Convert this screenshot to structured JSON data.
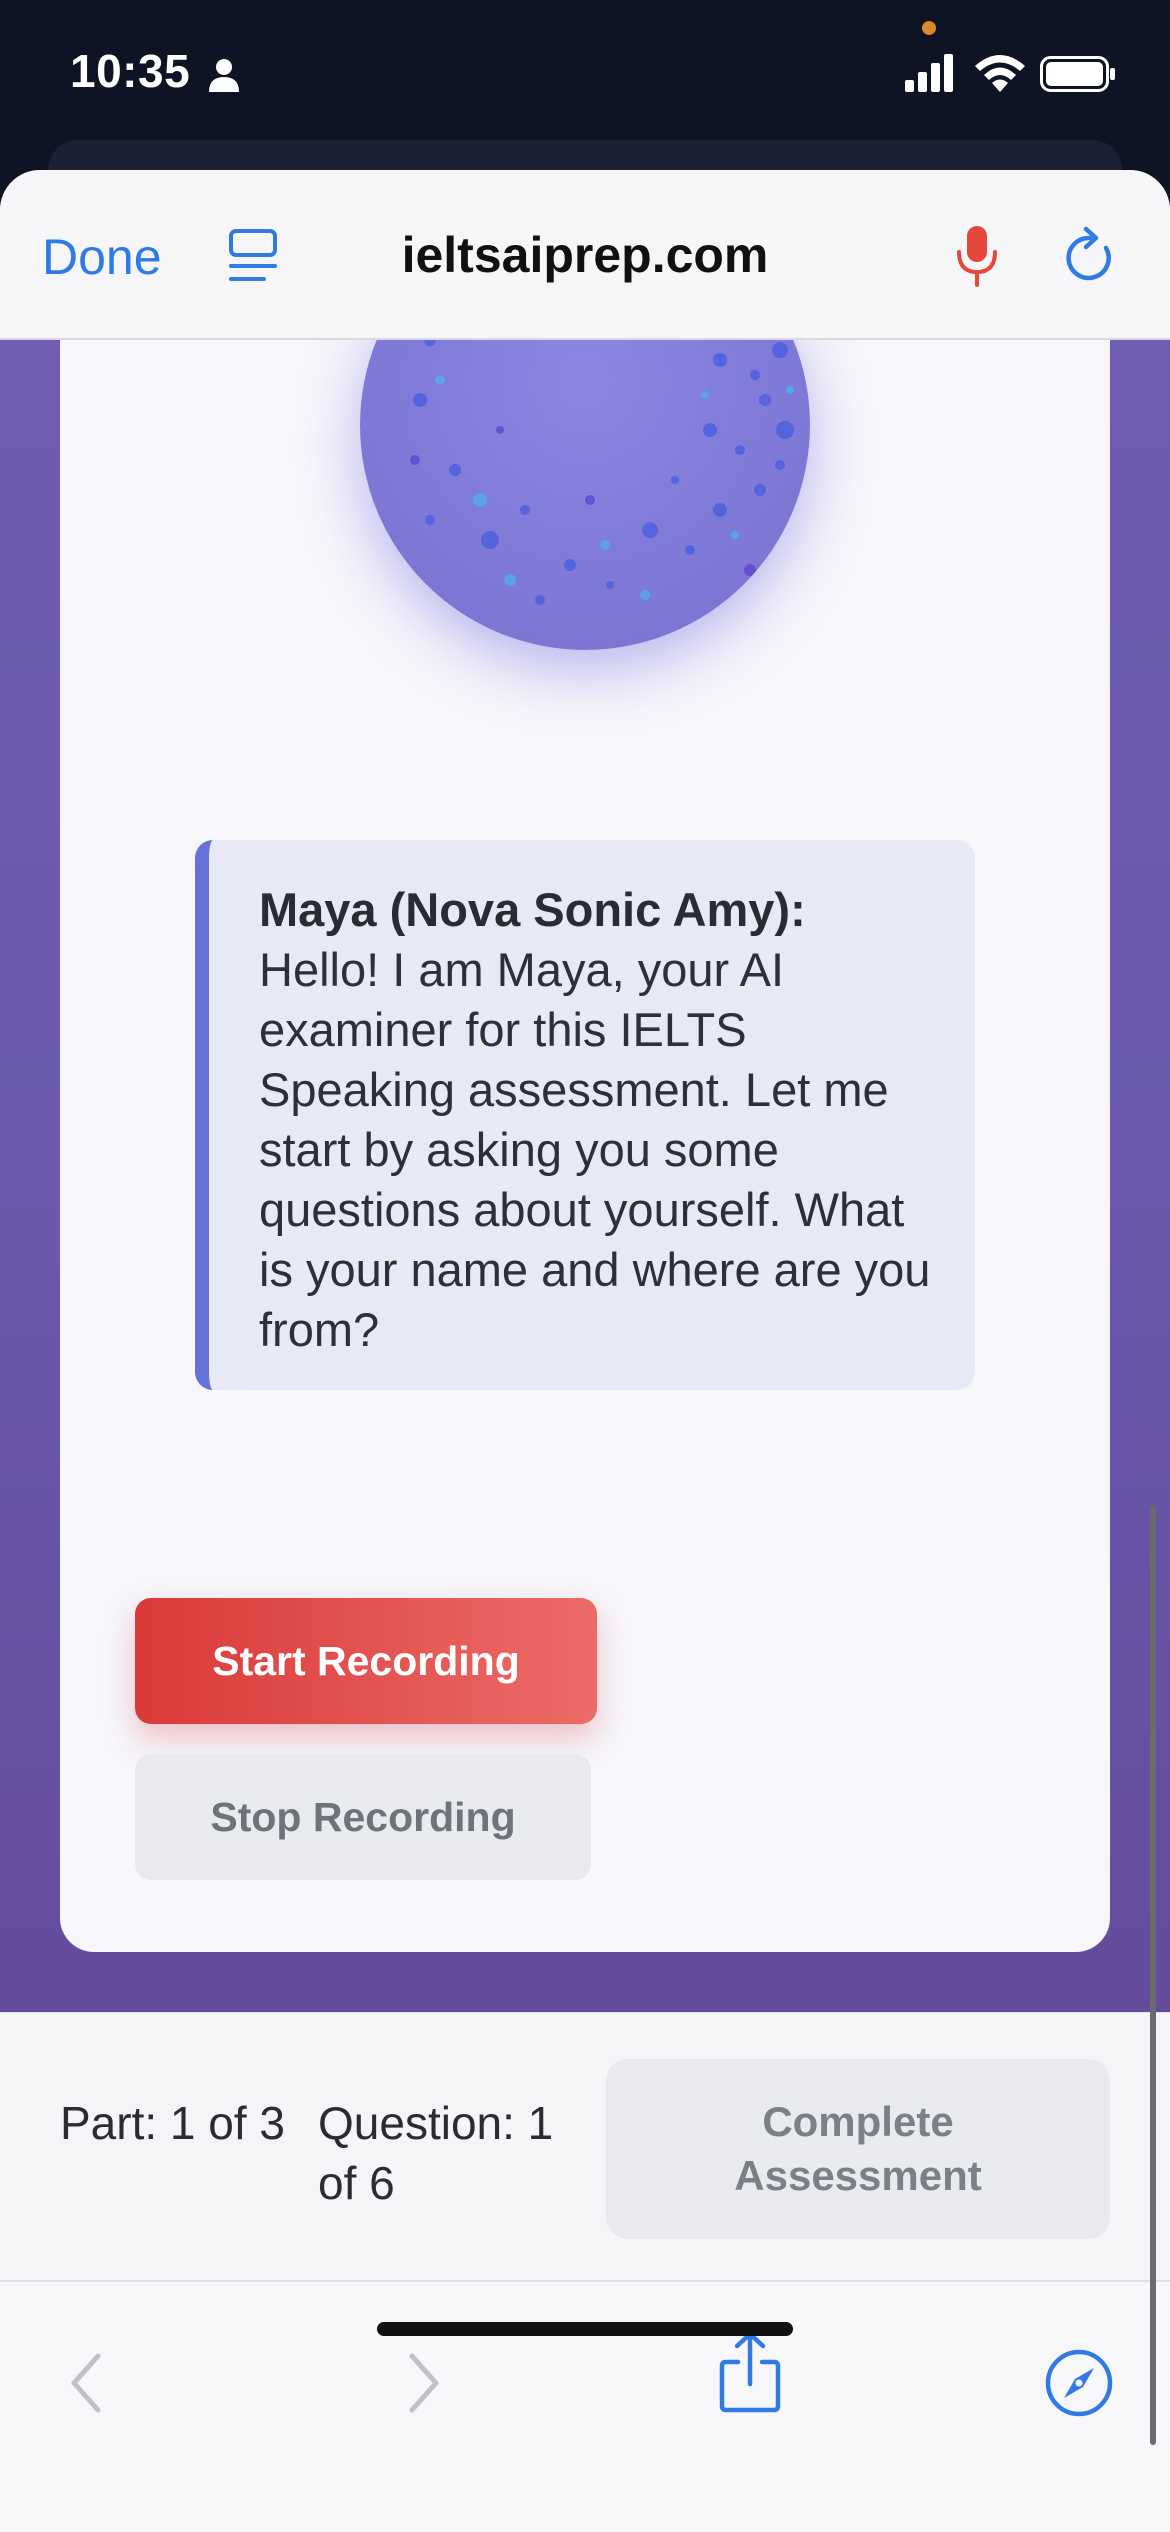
{
  "status_bar": {
    "time": "10:35",
    "icons": [
      "person-icon",
      "signal-icon",
      "wifi-icon",
      "battery-icon"
    ]
  },
  "browser": {
    "done_label": "Done",
    "domain": "ieltsaiprep.com",
    "icons": [
      "reader-icon",
      "mic-icon",
      "reload-icon"
    ]
  },
  "conversation": {
    "speaker": "Maya (Nova Sonic Amy):",
    "message": "Hello! I am Maya, your AI examiner for this IELTS Speaking assessment. Let me start by asking you some questions about yourself. What is your name and where are you from?"
  },
  "controls": {
    "start_label": "Start Recording",
    "stop_label": "Stop Recording"
  },
  "progress": {
    "part": "Part: 1 of 3",
    "question": "Question: 1 of 6",
    "complete_label": "Complete Assessment"
  },
  "toolbar": {
    "icons": [
      "back-arrow-icon",
      "forward-arrow-icon",
      "share-icon",
      "safari-compass-icon"
    ]
  },
  "colors": {
    "accent_blue": "#2f7ae5",
    "record_red": "#d93a38",
    "page_purple": "#6e5db2",
    "bubble_border": "#6672d8",
    "mic_red": "#e5483a"
  }
}
